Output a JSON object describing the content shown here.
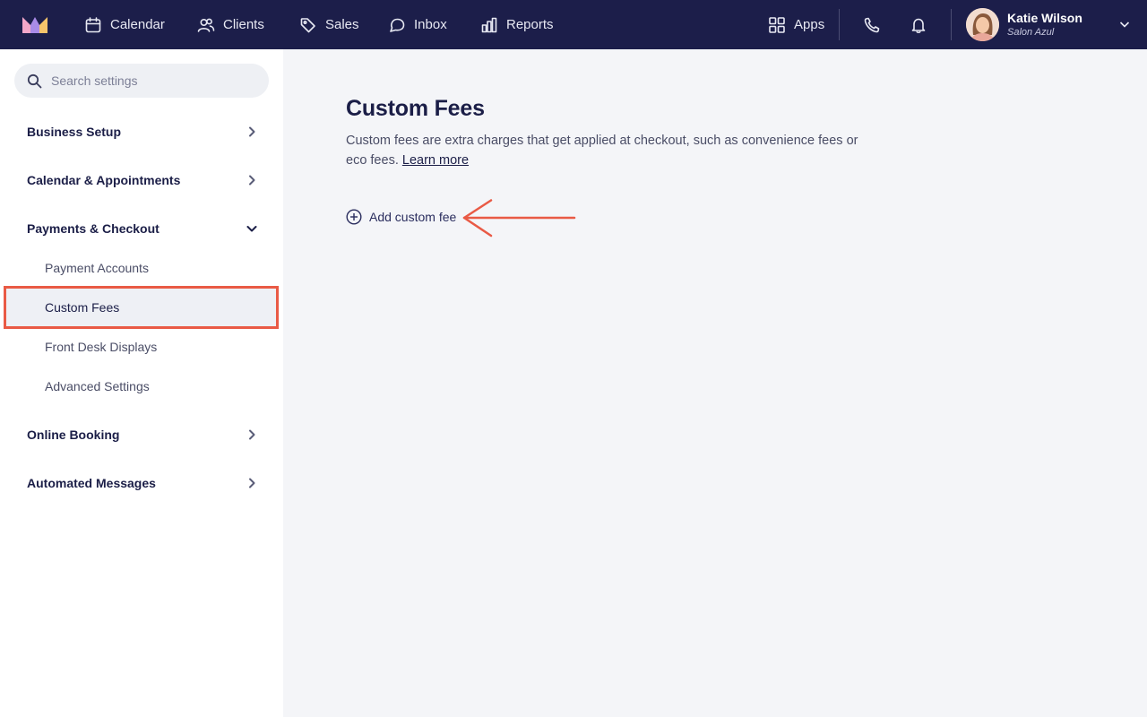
{
  "app": {
    "brand_colors": {
      "topbar": "#1c1e4a",
      "accent": "#e95a45"
    }
  },
  "topbar": {
    "nav": [
      {
        "label": "Calendar",
        "icon": "calendar-icon"
      },
      {
        "label": "Clients",
        "icon": "clients-icon"
      },
      {
        "label": "Sales",
        "icon": "tag-icon"
      },
      {
        "label": "Inbox",
        "icon": "chat-icon"
      },
      {
        "label": "Reports",
        "icon": "bar-chart-icon"
      }
    ],
    "apps_label": "Apps",
    "user": {
      "name": "Katie Wilson",
      "org": "Salon Azul"
    }
  },
  "sidebar": {
    "search_placeholder": "Search settings",
    "sections": [
      {
        "label": "Business Setup",
        "expanded": false
      },
      {
        "label": "Calendar & Appointments",
        "expanded": false
      },
      {
        "label": "Payments & Checkout",
        "expanded": true
      },
      {
        "label": "Online Booking",
        "expanded": false
      },
      {
        "label": "Automated Messages",
        "expanded": false
      }
    ],
    "payments_items": [
      {
        "label": "Payment Accounts"
      },
      {
        "label": "Custom Fees",
        "active": true
      },
      {
        "label": "Front Desk Displays"
      },
      {
        "label": "Advanced Settings"
      }
    ]
  },
  "main": {
    "title": "Custom Fees",
    "description": "Custom fees are extra charges that get applied at checkout, such as convenience fees or eco fees.",
    "learn_more": "Learn more",
    "add_button": "Add custom fee"
  }
}
